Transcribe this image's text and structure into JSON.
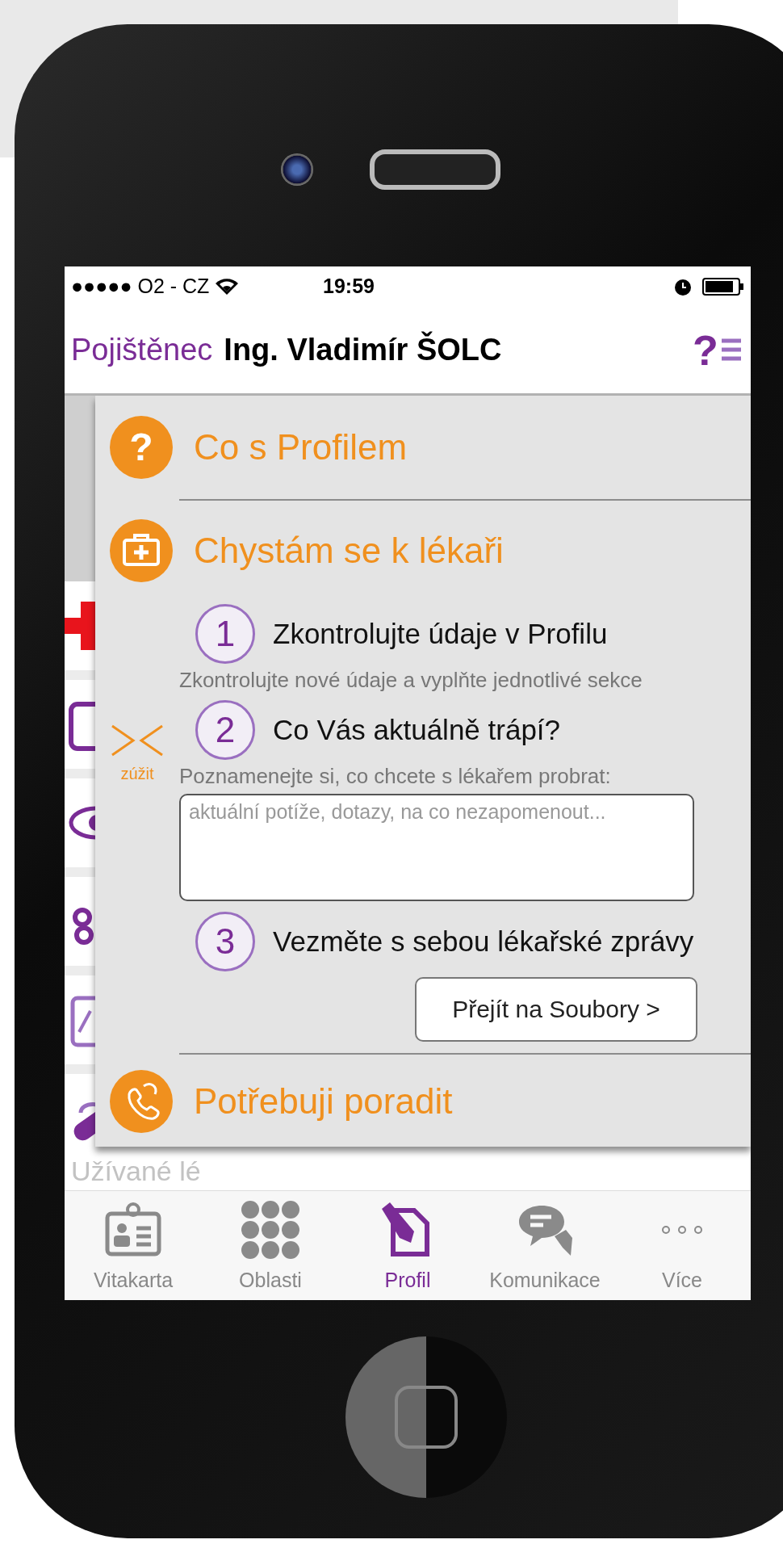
{
  "status_bar": {
    "carrier": "●●●●● O2 - CZ",
    "time": "19:59"
  },
  "header": {
    "label": "Pojištěnec",
    "name": "Ing. Vladimír ŠOLC",
    "help_glyph": "?"
  },
  "background_list": {
    "partial_text": "Užívané lé"
  },
  "panel": {
    "collapse_label": "zúžit",
    "sections": [
      {
        "kind": "question",
        "icon_glyph": "?",
        "title": "Co s Profilem",
        "expanded": false
      },
      {
        "kind": "kit",
        "title": "Chystám se k lékaři",
        "expanded": true,
        "steps": [
          {
            "number": "1",
            "title": "Zkontrolujte údaje v Profilu",
            "description": "Zkontrolujte nové údaje a vyplňte jednotlivé sekce"
          },
          {
            "number": "2",
            "title": "Co Vás aktuálně trápí?",
            "description": "Poznamenejte si, co chcete s lékařem probrat:",
            "placeholder": "aktuální potíže, dotazy, na co nezapomenout..."
          },
          {
            "number": "3",
            "title": "Vezměte s sebou lékařské zprávy",
            "button": "Přejít na Soubory >"
          }
        ]
      },
      {
        "kind": "phone",
        "title": "Potřebuji poradit",
        "expanded": false
      }
    ]
  },
  "tabs": [
    {
      "label": "Vitakarta",
      "selected": false
    },
    {
      "label": "Oblasti",
      "selected": false
    },
    {
      "label": "Profil",
      "selected": true
    },
    {
      "label": "Komunikace",
      "selected": false
    },
    {
      "label": "Více",
      "selected": false
    }
  ]
}
